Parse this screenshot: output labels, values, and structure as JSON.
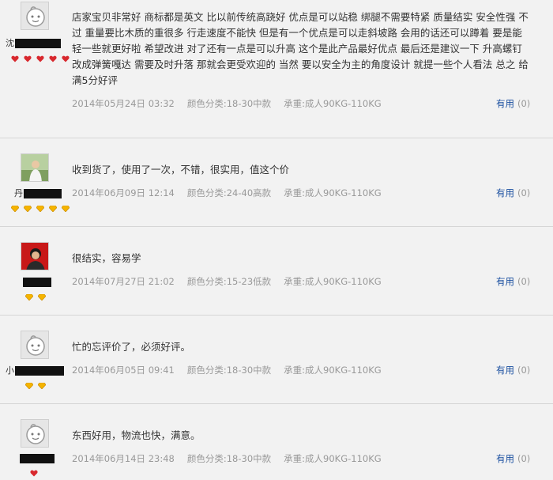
{
  "reviews": [
    {
      "username_visible": "沈",
      "avatar": "default-avatar-icon",
      "rank_icon": "red-heart-icon",
      "rank_count": 5,
      "content": "店家宝贝非常好 商标都是英文 比以前传统高跷好 优点是可以站稳 绑腿不需要特紧 质量结实 安全性强 不过 重量要比木质的重很多 行走速度不能快 但是有一个优点是可以走斜坡路 会用的话还可以蹲着 要是能轻一些就更好啦 希望改进 对了还有一点是可以升高 这个是此产品最好优点 最后还是建议一下 升高螺钉改成弹簧嘎达 需要及时升落 那就会更受欢迎的 当然 要以安全为主的角度设计 就提一些个人看法 总之 给满5分好评",
      "date": "2014年05月24日 03:32",
      "color": "颜色分类:18-30中款",
      "weight": "承重:成人90KG-110KG",
      "useful_label": "有用",
      "useful_count": "(0)"
    },
    {
      "username_visible": "丹",
      "avatar": "user-photo-avatar",
      "rank_icon": "yellow-diamond-icon",
      "rank_count": 5,
      "content": "收到货了，使用了一次，不错，很实用，值这个价",
      "date": "2014年06月09日 12:14",
      "color": "颜色分类:24-40高款",
      "weight": "承重:成人90KG-110KG",
      "useful_label": "有用",
      "useful_count": "(0)"
    },
    {
      "username_visible": "",
      "avatar": "red-user-photo-avatar",
      "rank_icon": "yellow-diamond-icon",
      "rank_count": 2,
      "content": "很结实，容易学",
      "date": "2014年07月27日 21:02",
      "color": "颜色分类:15-23低款",
      "weight": "承重:成人90KG-110KG",
      "useful_label": "有用",
      "useful_count": "(0)"
    },
    {
      "username_visible": "小",
      "avatar": "default-avatar-icon",
      "rank_icon": "yellow-diamond-icon",
      "rank_count": 2,
      "content": "忙的忘评价了，必须好评。",
      "date": "2014年06月05日 09:41",
      "color": "颜色分类:18-30中款",
      "weight": "承重:成人90KG-110KG",
      "useful_label": "有用",
      "useful_count": "(0)"
    },
    {
      "username_visible": "",
      "avatar": "default-avatar-icon",
      "rank_icon": "red-heart-icon",
      "rank_count": 1,
      "content": "东西好用，物流也快，满意。",
      "date": "2014年06月14日 23:48",
      "color": "颜色分类:18-30中款",
      "weight": "承重:成人90KG-110KG",
      "useful_label": "有用",
      "useful_count": "(0)"
    }
  ]
}
